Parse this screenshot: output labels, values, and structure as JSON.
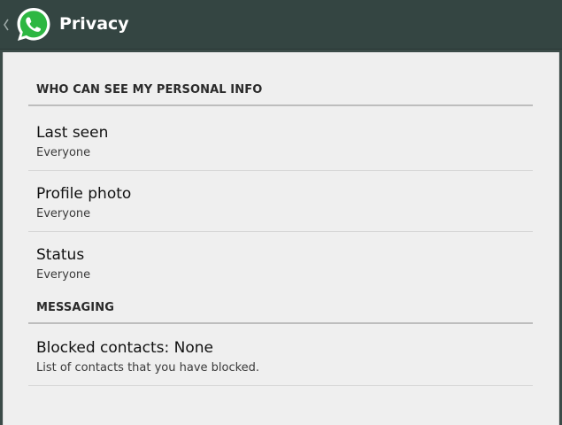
{
  "action_bar": {
    "title": "Privacy",
    "icon": "whatsapp-logo",
    "back_icon": "chevron-left-icon",
    "accent": "#2db742"
  },
  "sections": [
    {
      "header": "WHO CAN SEE MY PERSONAL INFO",
      "items": [
        {
          "title": "Last seen",
          "summary": "Everyone"
        },
        {
          "title": "Profile photo",
          "summary": "Everyone"
        },
        {
          "title": "Status",
          "summary": "Everyone"
        }
      ]
    },
    {
      "header": "MESSAGING",
      "items": [
        {
          "title": "Blocked contacts: None",
          "summary": "List of contacts that you have blocked."
        }
      ]
    }
  ]
}
